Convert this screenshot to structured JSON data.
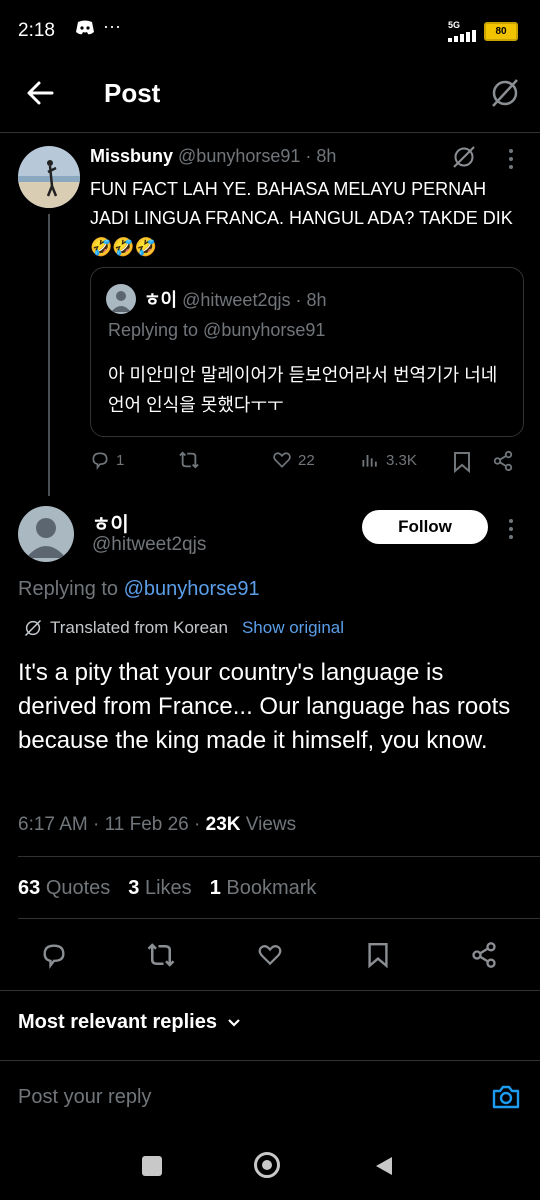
{
  "status": {
    "time": "2:18",
    "network": "5G",
    "battery": "80"
  },
  "header": {
    "title": "Post"
  },
  "parent": {
    "name": "Missbuny",
    "handle": "@bunyhorse91",
    "time": "· 8h",
    "text": "FUN FACT LAH YE. BAHASA MELAYU PERNAH JADI LINGUA FRANCA. HANGUL ADA? TAKDE DIK 🤣🤣🤣",
    "quote": {
      "name": "ㅎ이",
      "handle": "@hitweet2qjs",
      "time": "· 8h",
      "replying": "Replying to @bunyhorse91",
      "text": "아 미안미안 말레이어가 듣보언어라서 번역기가 너네 언어 인식을 못했다ㅜㅜ"
    },
    "replies": "1",
    "likes": "22",
    "views": "3.3K"
  },
  "main": {
    "name": "ㅎ이",
    "handle": "@hitweet2qjs",
    "follow": "Follow",
    "replying_prefix": "Replying to",
    "replying_handle": "@bunyhorse91",
    "translated": "Translated from Korean",
    "show_original": "Show original",
    "text": "It's a pity that your country's language is derived from France... Our language has roots because the king made it himself, you know.",
    "timestamp": "6:17 AM · 11 Feb 26 ·",
    "views_count": "23K",
    "views_label": "Views",
    "quotes_count": "63",
    "quotes_label": "Quotes",
    "likes_count": "3",
    "likes_label": "Likes",
    "bookmarks_count": "1",
    "bookmarks_label": "Bookmark"
  },
  "replies_filter": "Most relevant replies",
  "reply_placeholder": "Post your reply",
  "colors": {
    "accent": "#1d9bf0",
    "link": "#5b9ee9",
    "background": "#000000",
    "muted": "#71767b"
  }
}
